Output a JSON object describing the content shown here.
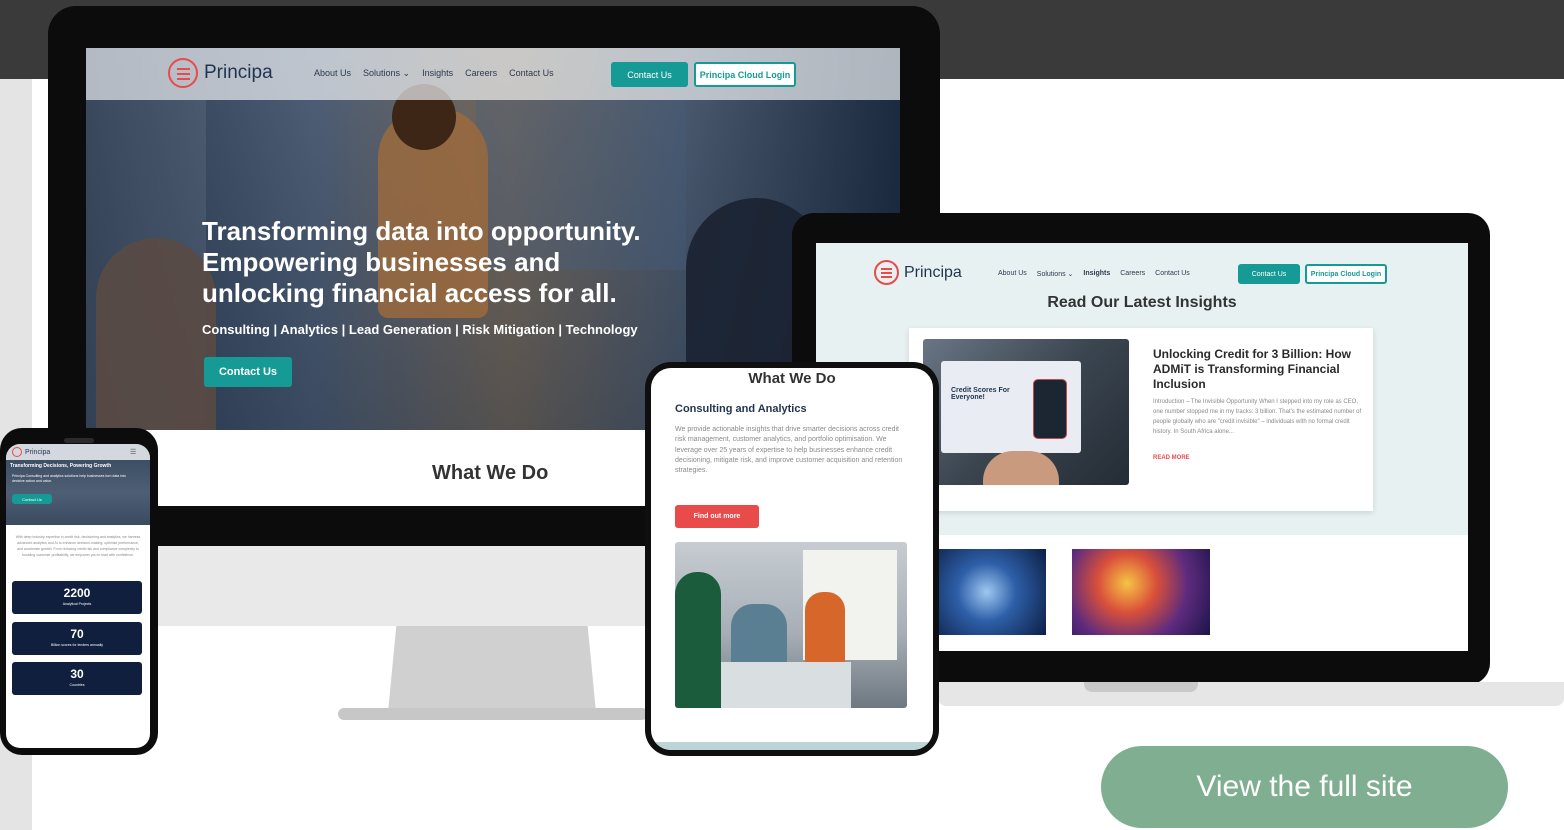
{
  "brand": {
    "name": "Principa",
    "accent": "#159a95",
    "red": "#e94a4a",
    "navy": "#0f1f3d"
  },
  "desktop": {
    "nav": {
      "links": [
        "About Us",
        "Solutions ⌄",
        "Insights",
        "Careers",
        "Contact Us"
      ],
      "contact_button": "Contact Us",
      "cloud_login_button": "Principa Cloud Login"
    },
    "hero": {
      "headline_lines": [
        "Transforming data into opportunity.",
        "Empowering businesses and",
        "unlocking financial access for all."
      ],
      "subline": "Consulting | Analytics | Lead Generation | Risk Mitigation | Technology",
      "cta": "Contact Us"
    },
    "section_title": "What We Do"
  },
  "laptop": {
    "nav": {
      "links": [
        "About Us",
        "Solutions ⌄",
        "Insights",
        "Careers",
        "Contact Us"
      ],
      "active": "Insights",
      "contact_button": "Contact Us",
      "cloud_login_button": "Principa Cloud Login"
    },
    "heading": "Read Our Latest Insights",
    "card": {
      "image_caption": "Credit Scores For Everyone!",
      "title": "Unlocking Credit for 3 Billion: How ADMiT is Transforming Financial Inclusion",
      "excerpt": "Introduction – The Invisible Opportunity When I stepped into my role as CEO, one number stopped me in my tracks: 3 billion. That's the estimated number of people globally who are \"credit invisible\" – individuals with no formal credit history. In South Africa alone...",
      "read_more": "READ MORE"
    }
  },
  "tablet": {
    "title": "What We Do",
    "subtitle": "Consulting and Analytics",
    "body": "We provide actionable insights that drive smarter decisions across credit risk management, customer analytics, and portfolio optimisation. We leverage over 25 years of expertise to help businesses enhance credit decisioning, mitigate risk, and improve customer acquisition and retention strategies.",
    "button": "Find out more"
  },
  "phone": {
    "menu_icon": "☰",
    "hero_title": "Transforming Decisions, Powering Growth",
    "hero_text": "Principa Consulting and analytics solutions help businesses turn data into decisive action and value.",
    "hero_button": "Contact Us",
    "body": "With deep industry expertise in credit risk, decisioning and analytics, we harness advanced analytics and AI to enhance decision-making, optimise performance, and accelerate growth. From reducing credit risk and compliance complexity to boosting customer profitability, we empower you to lead with confidence.",
    "stats": [
      {
        "value": "2200",
        "label": "Analytical Projects"
      },
      {
        "value": "70",
        "label": "Billion scores for lenders annually"
      },
      {
        "value": "30",
        "label": "Countries"
      }
    ]
  },
  "cta": {
    "label": "View the full site",
    "color": "#7fae91"
  }
}
